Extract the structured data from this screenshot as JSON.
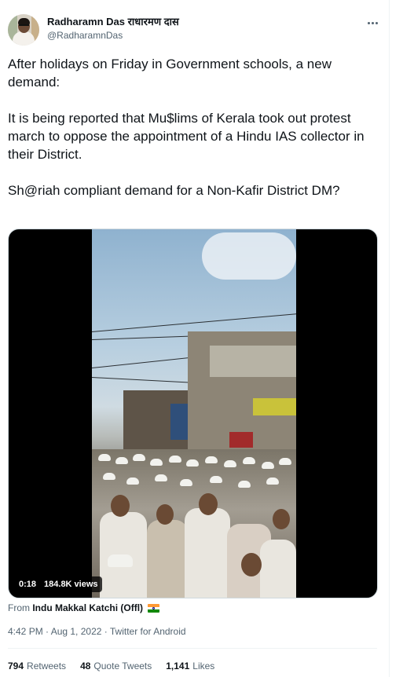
{
  "author": {
    "display_name": "Radharamn Das राधारमण दास",
    "handle": "@RadharamnDas",
    "avatar": "profile-photo"
  },
  "more_menu_icon": "ellipsis-icon",
  "tweet": {
    "paragraphs": [
      "After holidays on Friday in Government schools, a new demand:",
      "It is being reported that Mu$lims of Kerala took out protest march to oppose the appointment of a Hindu IAS collector in their District.",
      "Sh@riah compliant demand for a Non-Kafir District DM?"
    ]
  },
  "video": {
    "duration": "0:18",
    "views": "184.8K views"
  },
  "attribution": {
    "prefix": "From",
    "source": "Indu Makkal Katchi (Offl)",
    "flag": "india-flag"
  },
  "meta": {
    "timestamp": "4:42 PM · Aug 1, 2022 · Twitter for Android"
  },
  "stats": {
    "retweets_count": "794",
    "retweets_label": "Retweets",
    "quotes_count": "48",
    "quotes_label": "Quote Tweets",
    "likes_count": "1,141",
    "likes_label": "Likes"
  }
}
